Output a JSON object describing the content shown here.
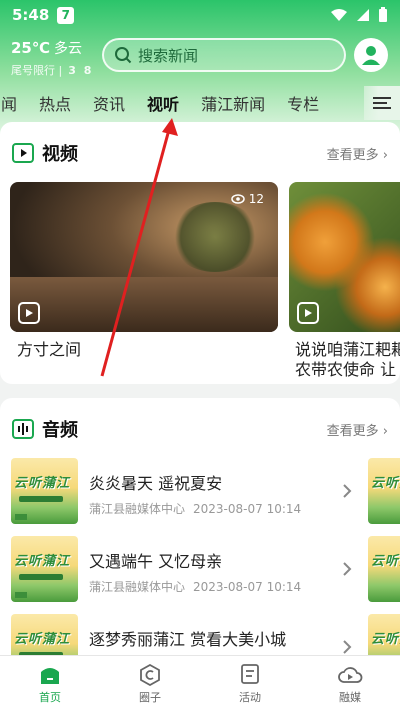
{
  "status_bar": {
    "time": "5:48",
    "app_badge": "7"
  },
  "header": {
    "temperature": "25℃",
    "weather": "多云",
    "traffic_limit_label": "尾号限行",
    "traffic_limit_sep": "|",
    "traffic_limit_numbers": "3 8",
    "search_placeholder": "搜索新闻"
  },
  "tabs": [
    {
      "label": "闻"
    },
    {
      "label": "热点"
    },
    {
      "label": "资讯"
    },
    {
      "label": "视听",
      "active": true
    },
    {
      "label": "蒲江新闻"
    },
    {
      "label": "专栏"
    }
  ],
  "video_section": {
    "title": "视频",
    "see_more": "查看更多",
    "items": [
      {
        "title": "方寸之间",
        "views": "12"
      },
      {
        "title": "说说咱蒲江耙耙柑…",
        "title_line2": "农带农使命 让"
      }
    ]
  },
  "audio_section": {
    "title": "音频",
    "see_more": "查看更多",
    "thumb_label": "云听蒲江",
    "items": [
      {
        "title": "炎炎暑天 遥祝夏安",
        "source": "蒲江县融媒体中心",
        "date": "2023-08-07 10:14"
      },
      {
        "title": "又遇端午 又忆母亲",
        "source": "蒲江县融媒体中心",
        "date": "2023-08-07 10:14"
      },
      {
        "title": "逐梦秀丽蒲江 赏看大美小城",
        "source": "",
        "date": ""
      }
    ]
  },
  "bottom_nav": [
    {
      "label": "首页",
      "icon": "home-icon",
      "active": true
    },
    {
      "label": "圈子",
      "icon": "circle-icon"
    },
    {
      "label": "活动",
      "icon": "activity-icon"
    },
    {
      "label": "融媒",
      "icon": "cloud-media-icon"
    }
  ],
  "colors": {
    "brand_green": "#1aa74f",
    "tab_indicator": "#f2c232",
    "annotation_arrow": "#e02020"
  }
}
